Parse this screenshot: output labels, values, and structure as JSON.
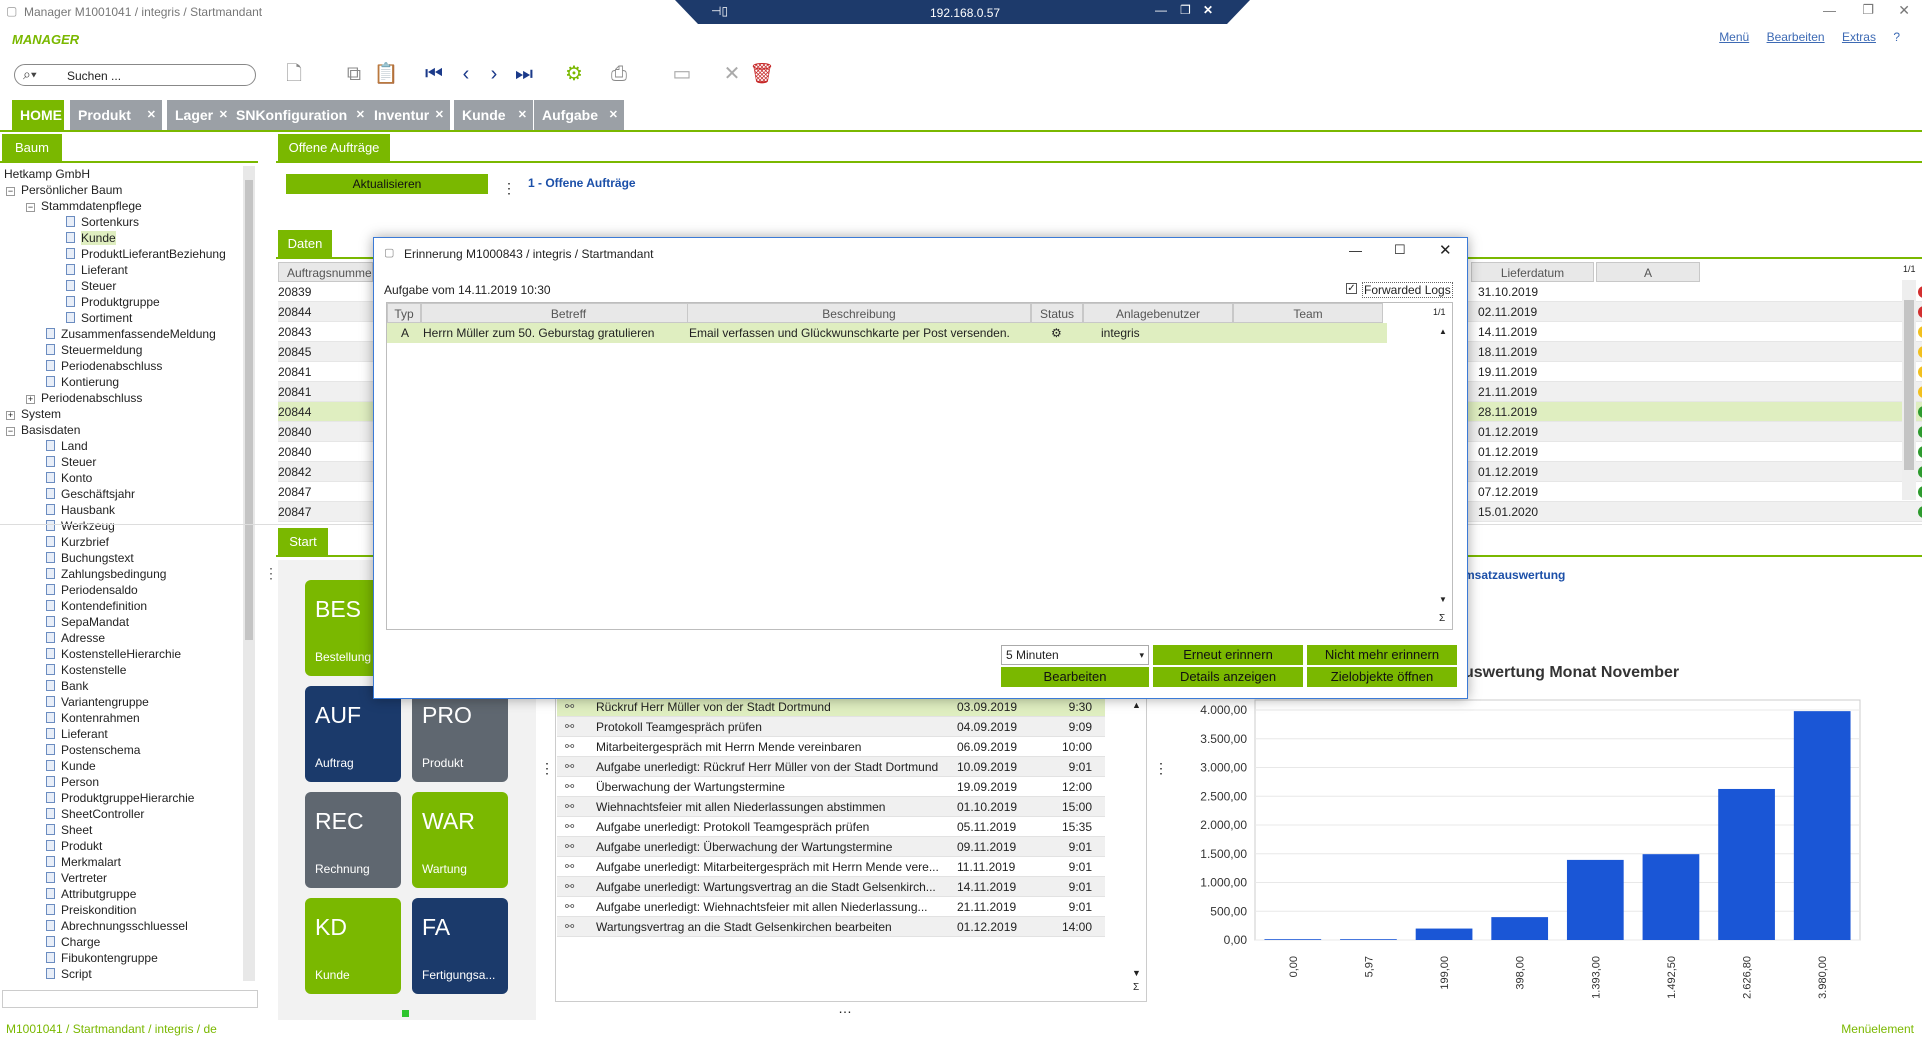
{
  "window": {
    "title": "Manager M1001041 / integris / Startmandant",
    "rdp_ip": "192.168.0.57"
  },
  "brand": "MANAGER",
  "topmenu": [
    "Menü",
    "Bearbeiten",
    "Extras",
    "?"
  ],
  "search": {
    "placeholder": "Suchen ..."
  },
  "tabs": [
    {
      "label": "HOME"
    },
    {
      "label": "Produkt"
    },
    {
      "label": "Lager"
    },
    {
      "label": "SNKonfiguration"
    },
    {
      "label": "Inventur"
    },
    {
      "label": "Kunde"
    },
    {
      "label": "Aufgabe"
    }
  ],
  "left": {
    "panel": "Baum",
    "company": "Hetkamp GmbH"
  },
  "tree": [
    {
      "label": "Persönlicher Baum",
      "lvl": 0,
      "exp": "⊟"
    },
    {
      "label": "Stammdatenpflege",
      "lvl": 1,
      "exp": "⊟"
    },
    {
      "label": "Sortenkurs",
      "lvl": 3
    },
    {
      "label": "Kunde",
      "lvl": 3,
      "sel": true
    },
    {
      "label": "ProduktLieferantBeziehung",
      "lvl": 3
    },
    {
      "label": "Lieferant",
      "lvl": 3
    },
    {
      "label": "Steuer",
      "lvl": 3
    },
    {
      "label": "Produktgruppe",
      "lvl": 3
    },
    {
      "label": "Sortiment",
      "lvl": 3
    },
    {
      "label": "ZusammenfassendeMeldung",
      "lvl": 2
    },
    {
      "label": "Steuermeldung",
      "lvl": 2
    },
    {
      "label": "Periodenabschluss",
      "lvl": 2
    },
    {
      "label": "Kontierung",
      "lvl": 2
    },
    {
      "label": "Periodenabschluss",
      "lvl": 1,
      "exp": "⊞"
    },
    {
      "label": "System",
      "lvl": 0,
      "exp": "⊞"
    },
    {
      "label": "Basisdaten",
      "lvl": 0,
      "exp": "⊟"
    },
    {
      "label": "Land",
      "lvl": 2
    },
    {
      "label": "Steuer",
      "lvl": 2
    },
    {
      "label": "Konto",
      "lvl": 2
    },
    {
      "label": "Geschäftsjahr",
      "lvl": 2
    },
    {
      "label": "Hausbank",
      "lvl": 2
    },
    {
      "label": "Werkzeug",
      "lvl": 2
    },
    {
      "label": "Kurzbrief",
      "lvl": 2
    },
    {
      "label": "Buchungstext",
      "lvl": 2
    },
    {
      "label": "Zahlungsbedingung",
      "lvl": 2
    },
    {
      "label": "Periodensaldo",
      "lvl": 2
    },
    {
      "label": "Kontendefinition",
      "lvl": 2
    },
    {
      "label": "SepaMandat",
      "lvl": 2
    },
    {
      "label": "Adresse",
      "lvl": 2
    },
    {
      "label": "KostenstelleHierarchie",
      "lvl": 2
    },
    {
      "label": "Kostenstelle",
      "lvl": 2
    },
    {
      "label": "Bank",
      "lvl": 2
    },
    {
      "label": "Variantengruppe",
      "lvl": 2
    },
    {
      "label": "Kontenrahmen",
      "lvl": 2
    },
    {
      "label": "Lieferant",
      "lvl": 2
    },
    {
      "label": "Postenschema",
      "lvl": 2
    },
    {
      "label": "Kunde",
      "lvl": 2
    },
    {
      "label": "Person",
      "lvl": 2
    },
    {
      "label": "ProduktgruppeHierarchie",
      "lvl": 2
    },
    {
      "label": "SheetController",
      "lvl": 2
    },
    {
      "label": "Sheet",
      "lvl": 2
    },
    {
      "label": "Produkt",
      "lvl": 2
    },
    {
      "label": "Merkmalart",
      "lvl": 2
    },
    {
      "label": "Vertreter",
      "lvl": 2
    },
    {
      "label": "Attributgruppe",
      "lvl": 2
    },
    {
      "label": "Preiskondition",
      "lvl": 2
    },
    {
      "label": "Abrechnungsschluessel",
      "lvl": 2
    },
    {
      "label": "Charge",
      "lvl": 2
    },
    {
      "label": "Fibukontengruppe",
      "lvl": 2
    },
    {
      "label": "Script",
      "lvl": 2
    }
  ],
  "main": {
    "tab": "Offene Aufträge",
    "refresh": "Aktualisieren",
    "section": "1 - Offene Aufträge",
    "daten": "Daten",
    "col_auftrag": "Auftragsnumme",
    "col_liefer": "Lieferdatum",
    "col_a": "A",
    "page": "1/1",
    "orders": [
      {
        "nr": "20839",
        "date": "31.10.2019",
        "c": "#d32f2f"
      },
      {
        "nr": "20844",
        "date": "02.11.2019",
        "c": "#d32f2f"
      },
      {
        "nr": "20843",
        "date": "14.11.2019",
        "c": "#f2c01e"
      },
      {
        "nr": "20845",
        "date": "18.11.2019",
        "c": "#f2c01e"
      },
      {
        "nr": "20841",
        "date": "19.11.2019",
        "c": "#f2c01e"
      },
      {
        "nr": "20841",
        "date": "21.11.2019",
        "c": "#f2c01e"
      },
      {
        "nr": "20844",
        "date": "28.11.2019",
        "c": "#2e9b2e",
        "sel": true
      },
      {
        "nr": "20840",
        "date": "01.12.2019",
        "c": "#2e9b2e"
      },
      {
        "nr": "20840",
        "date": "01.12.2019",
        "c": "#2e9b2e"
      },
      {
        "nr": "20842",
        "date": "01.12.2019",
        "c": "#2e9b2e"
      },
      {
        "nr": "20847",
        "date": "07.12.2019",
        "c": "#2e9b2e"
      },
      {
        "nr": "20847",
        "date": "15.01.2020",
        "c": "#2e9b2e"
      }
    ]
  },
  "start": {
    "label": "Start",
    "tiles": [
      {
        "code": "BES",
        "sub": "Bestellung",
        "c": "#7ab800"
      },
      {
        "code": "AUF",
        "sub": "Auftrag",
        "c": "#1b3a6b"
      },
      {
        "code": "PRO",
        "sub": "Produkt",
        "c": "#5f6770"
      },
      {
        "code": "REC",
        "sub": "Rechnung",
        "c": "#5f6770"
      },
      {
        "code": "WAR",
        "sub": "Wartung",
        "c": "#7ab800"
      },
      {
        "code": "KD",
        "sub": "Kunde",
        "c": "#7ab800"
      },
      {
        "code": "FA",
        "sub": "Fertigungsa...",
        "c": "#1b3a6b"
      }
    ]
  },
  "tasks": [
    {
      "t": "Rückruf Herr Müller von der Stadt Dortmund",
      "d": "03.09.2019",
      "h": "9:30",
      "sel": true
    },
    {
      "t": "Protokoll Teamgespräch prüfen",
      "d": "04.09.2019",
      "h": "9:09"
    },
    {
      "t": "Mitarbeitergespräch mit Herrn Mende vereinbaren",
      "d": "06.09.2019",
      "h": "10:00"
    },
    {
      "t": "Aufgabe unerledigt: Rückruf Herr Müller von der Stadt Dortmund",
      "d": "10.09.2019",
      "h": "9:01"
    },
    {
      "t": "Überwachung der Wartungstermine",
      "d": "19.09.2019",
      "h": "12:00"
    },
    {
      "t": "Wiehnachtsfeier mit allen Niederlassungen abstimmen",
      "d": "01.10.2019",
      "h": "15:00"
    },
    {
      "t": "Aufgabe unerledigt: Protokoll Teamgespräch prüfen",
      "d": "05.11.2019",
      "h": "15:35"
    },
    {
      "t": "Aufgabe unerledigt: Überwachung der Wartungstermine",
      "d": "09.11.2019",
      "h": "9:01"
    },
    {
      "t": "Aufgabe unerledigt: Mitarbeitergespräch mit Herrn Mende vere...",
      "d": "11.11.2019",
      "h": "9:01"
    },
    {
      "t": "Aufgabe unerledigt: Wartungsvertrag an die Stadt Gelsenkirch...",
      "d": "14.11.2019",
      "h": "9:01"
    },
    {
      "t": "Aufgabe unerledigt: Wiehnachtsfeier mit allen Niederlassung...",
      "d": "21.11.2019",
      "h": "9:01"
    },
    {
      "t": "Wartungsvertrag an die Stadt Gelsenkirchen bearbeiten",
      "d": "01.12.2019",
      "h": "14:00"
    }
  ],
  "umsatz": {
    "link": "msatzauswertung",
    "title": "uswertung Monat November"
  },
  "chart_data": {
    "type": "bar",
    "categories": [
      "0,00",
      "5,97",
      "199,00",
      "398,00",
      "1.393,00",
      "1.492,50",
      "2.626,80",
      "3.980,00"
    ],
    "values": [
      0,
      5.97,
      199,
      398,
      1393,
      1492.5,
      2626.8,
      3980
    ],
    "yticks": [
      "0,00",
      "500,00",
      "1.000,00",
      "1.500,00",
      "2.000,00",
      "2.500,00",
      "3.000,00",
      "3.500,00",
      "4.000,00"
    ],
    "ylim": [
      0,
      4000
    ],
    "color": "#1a56d6"
  },
  "dialog": {
    "title": "Erinnerung M1000843 / integris / Startmandant",
    "subtitle": "Aufgabe vom 14.11.2019 10:30",
    "forwarded": "Forwarded Logs",
    "cols": [
      "Typ",
      "Betreff",
      "Beschreibung",
      "Status",
      "Anlagebenutzer",
      "Team"
    ],
    "page": "1/1",
    "row": {
      "typ": "A",
      "betreff": "Herrn Müller zum 50. Geburstag gratulieren",
      "beschreibung": "Email verfassen und Glückwunschkarte per Post versenden.",
      "user": "integris"
    },
    "select": "5 Minuten",
    "btns": [
      "Erneut erinnern",
      "Nicht mehr erinnern",
      "Bearbeiten",
      "Details anzeigen",
      "Zielobjekte öffnen"
    ],
    "sigma": "Σ"
  },
  "status": {
    "left": "M1001041 / Startmandant / integris / de",
    "right": "Menüelement"
  }
}
